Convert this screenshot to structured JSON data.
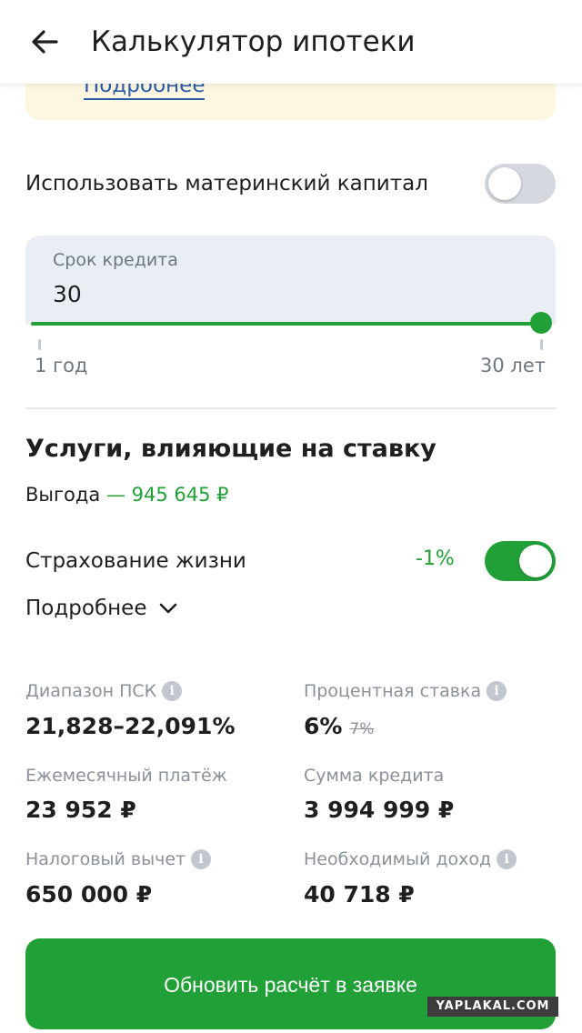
{
  "header": {
    "title": "Калькулятор ипотеки"
  },
  "info_banner": {
    "link_label": "Подробнее"
  },
  "maternity_capital": {
    "label": "Использовать материнский капитал",
    "enabled": false
  },
  "loan_term": {
    "label": "Срок кредита",
    "value": "30",
    "min_label": "1 год",
    "max_label": "30 лет",
    "fraction": 1.0
  },
  "services": {
    "title": "Услуги, влияющие на ставку",
    "benefit_label": "Выгода",
    "benefit_value": "— 945 645 ₽",
    "life_insurance": {
      "label": "Страхование жизни",
      "discount": "-1%",
      "enabled": true
    },
    "more_label": "Подробнее"
  },
  "stats": {
    "psk_range": {
      "label": "Диапазон ПСК",
      "value": "21,828–22,091%"
    },
    "interest_rate": {
      "label": "Процентная ставка",
      "value": "6%",
      "old_value": "7%"
    },
    "monthly_payment": {
      "label": "Ежемесячный платёж",
      "value": "23 952 ₽"
    },
    "loan_amount": {
      "label": "Сумма кредита",
      "value": "3 994 999 ₽"
    },
    "tax_deduction": {
      "label": "Налоговый вычет",
      "value": "650 000 ₽"
    },
    "required_income": {
      "label": "Необходимый доход",
      "value": "40 718 ₽"
    },
    "info_glyph": "i"
  },
  "cta": {
    "label": "Обновить расчёт в заявке"
  },
  "watermark": {
    "text": "YAPLAKAL.COM"
  },
  "colors": {
    "accent": "#21a038",
    "link": "#2a5ba8",
    "banner": "#fdf7e1",
    "field": "#e9eef5"
  }
}
